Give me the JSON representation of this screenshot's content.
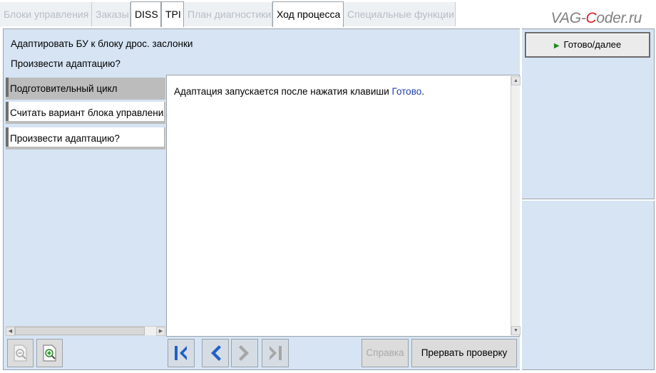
{
  "tabs": [
    {
      "label": "Блоки управления",
      "active": false
    },
    {
      "label": "Заказы",
      "active": false
    },
    {
      "label": "DISS",
      "active": true
    },
    {
      "label": "TPI",
      "active": true
    },
    {
      "label": "План диагностики",
      "active": false
    },
    {
      "label": "Ход процесса",
      "active": true
    },
    {
      "label": "Специальные функции",
      "active": false
    }
  ],
  "watermark": {
    "part1": "VAG-",
    "part2": "C",
    "part3": "oder.ru"
  },
  "header": {
    "title": "Адаптировать БУ к блоку дрос. заслонки",
    "question": "Произвести адаптацию?"
  },
  "ready_button": {
    "label": "Готово/далее"
  },
  "steps": [
    {
      "label": "Подготовительный цикл"
    },
    {
      "label": "Считать вариант блока управления"
    },
    {
      "label": "Произвести адаптацию?"
    }
  ],
  "content": {
    "text_before": "Адаптация запускается после нажатия клавиши ",
    "link": "Готово",
    "text_after": "."
  },
  "toolbar": {
    "help_label": "Справка",
    "abort_label": "Прервать проверку"
  },
  "icons": {
    "zoom_out": "zoom-out-icon",
    "zoom_in": "zoom-in-icon",
    "first": "skip-first-icon",
    "back": "chevron-left-icon",
    "forward": "chevron-right-icon",
    "last": "skip-last-icon"
  },
  "colors": {
    "panel_bg": "#d6e4f4",
    "link": "#1f3fb0",
    "nav_arrow": "#2060c8",
    "play": "#1f8a1f"
  }
}
